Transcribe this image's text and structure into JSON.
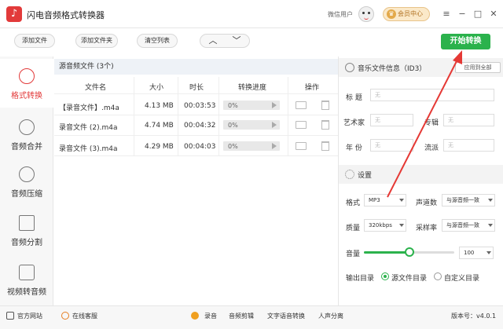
{
  "app": {
    "title": "闪电音频格式转换器",
    "logo_glyph": "♪",
    "user_label": "微信用户",
    "vip_label": "会员中心",
    "vip_icon": "crown-icon",
    "window_controls": [
      "≡",
      "−",
      "□",
      "✕"
    ]
  },
  "toolbar": {
    "add_file": "添加文件",
    "add_folder": "添加文件夹",
    "clear_list": "清空列表",
    "move_up": "︿",
    "move_down": "﹀",
    "start": "开始转换",
    "start_color": "#2bb24c"
  },
  "sidebar": {
    "items": [
      {
        "label": "格式转换",
        "icon": "refresh-icon",
        "active": true
      },
      {
        "label": "音频合并",
        "icon": "merge-icon",
        "active": false
      },
      {
        "label": "音频压缩",
        "icon": "compress-icon",
        "active": false
      },
      {
        "label": "音频分割",
        "icon": "split-icon",
        "active": false
      },
      {
        "label": "视频转音频",
        "icon": "video-icon",
        "active": false
      }
    ],
    "active_color": "#e23a3a"
  },
  "files": {
    "header": "源音频文件 (3个)",
    "columns": [
      "文件名",
      "大小",
      "时长",
      "转换进度",
      "操作"
    ],
    "rows": [
      {
        "name": "【录音文件】.m4a",
        "size": "4.13 MB",
        "duration": "00:03:53",
        "progress": "0%"
      },
      {
        "name": "录音文件 (2).m4a",
        "size": "4.74 MB",
        "duration": "00:04:32",
        "progress": "0%"
      },
      {
        "name": "录音文件 (3).m4a",
        "size": "4.29 MB",
        "duration": "00:04:03",
        "progress": "0%"
      }
    ]
  },
  "id3": {
    "header": "音乐文件信息（ID3）",
    "apply_all": "应用到全部",
    "fields": {
      "title_label": "标 题",
      "artist_label": "艺术家",
      "album_label": "专辑",
      "year_label": "年 份",
      "genre_label": "流派",
      "placeholder": "无"
    }
  },
  "settings": {
    "header": "设置",
    "format_label": "格式",
    "format_value": "MP3",
    "channels_label": "声道数",
    "channels_value": "与源音频一致",
    "quality_label": "质量",
    "quality_value": "320kbps",
    "samplerate_label": "采样率",
    "samplerate_value": "与源音频一致",
    "volume_label": "音量",
    "volume_value": "100",
    "volume_fraction": 0.5,
    "output_label": "输出目录",
    "output_source": "源文件目录",
    "output_custom": "自定义目录"
  },
  "bottombar": {
    "website": "官方网站",
    "support": "在线客服",
    "record": "录音",
    "edit": "音频剪辑",
    "tts": "文字语音转换",
    "vocal": "人声分离",
    "version": "版本号：v4.0.1"
  }
}
